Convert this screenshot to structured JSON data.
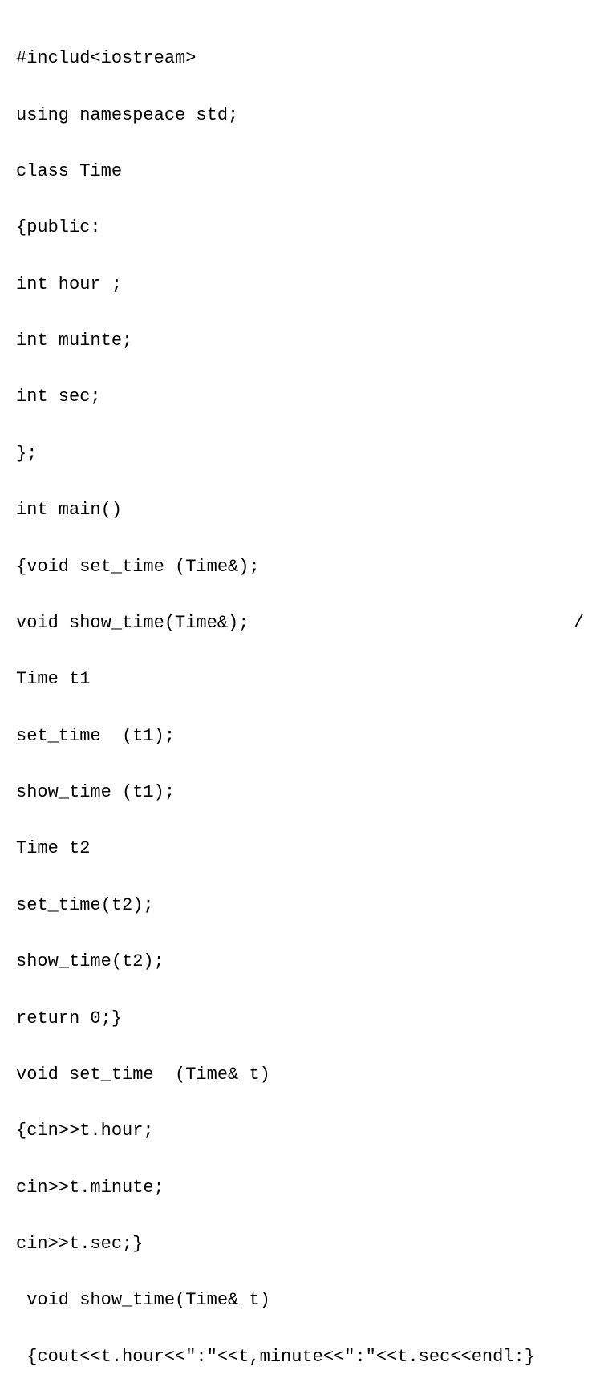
{
  "code": {
    "lines": [
      "#includ<iostream>",
      "using namespeace std;",
      "class Time",
      "{public:",
      "int hour ;",
      "int muinte;",
      "int sec;",
      "};",
      "int main()",
      "{void set_time (Time&);",
      "void show_time(Time&);",
      "Time t1",
      "set_time  (t1);",
      "show_time (t1);",
      "Time t2",
      "set_time(t2);",
      "show_time(t2);",
      "return 0;}",
      "void set_time  (Time& t)",
      "{cin>>t.hour;",
      "cin>>t.minute;",
      "cin>>t.sec;}",
      " void show_time(Time& t)",
      " {cout<<t.hour<<\":\"<<t,minute<<\":\"<<t.sec<<endl:}"
    ],
    "trailing_slash": "/"
  }
}
